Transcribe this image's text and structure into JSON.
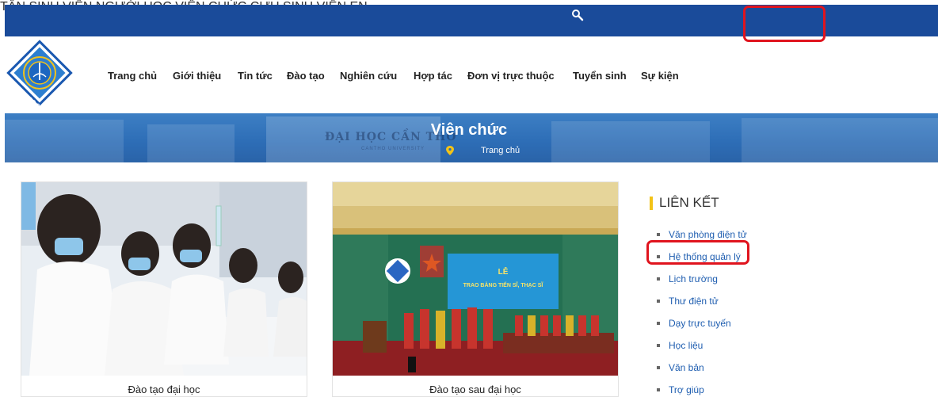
{
  "topbar": {
    "items": [
      {
        "label": "TÂN SINH VIÊN"
      },
      {
        "label": "NGƯỜI HỌC"
      },
      {
        "label": "VIÊN CHỨC"
      },
      {
        "label": "CỰU SINH VIÊN"
      },
      {
        "label": "EN"
      }
    ]
  },
  "nav": {
    "items": [
      {
        "label": "Trang chủ"
      },
      {
        "label": "Giới thiệu"
      },
      {
        "label": "Tin tức"
      },
      {
        "label": "Đào tạo"
      },
      {
        "label": "Nghiên cứu"
      },
      {
        "label": "Hợp tác"
      },
      {
        "label": "Đơn vị trực thuộc"
      },
      {
        "label": "Tuyển sinh"
      },
      {
        "label": "Sự kiện"
      }
    ]
  },
  "logo": {
    "ring_text": "ĐẠI HỌC CẦN THƠ"
  },
  "banner": {
    "title": "Viên chức",
    "breadcrumb": "Trang chủ",
    "sign_text": "ĐẠI HỌC CẦN THƠ",
    "sign_sub": "CANTHO UNIVERSITY"
  },
  "cards": [
    {
      "caption": "Đào tạo đại học"
    },
    {
      "caption": "Đào tạo sau đại học"
    }
  ],
  "photo2": {
    "screen_line1": "LỄ",
    "screen_line2": "TRAO BẰNG TIẾN SĨ, THẠC SĨ"
  },
  "sidebar": {
    "title": "LIÊN KẾT",
    "links": [
      {
        "label": "Văn phòng điện tử"
      },
      {
        "label": "Hệ thống quản lý"
      },
      {
        "label": "Lịch trường"
      },
      {
        "label": "Thư điện tử"
      },
      {
        "label": "Dạy trực tuyến"
      },
      {
        "label": "Học liệu"
      },
      {
        "label": "Văn bản"
      },
      {
        "label": "Trợ giúp"
      }
    ]
  },
  "colors": {
    "topbar_bg": "#1a4b9a",
    "highlight": "#e0141e",
    "link": "#1f5eb0",
    "accent_bar": "#f3c317"
  }
}
